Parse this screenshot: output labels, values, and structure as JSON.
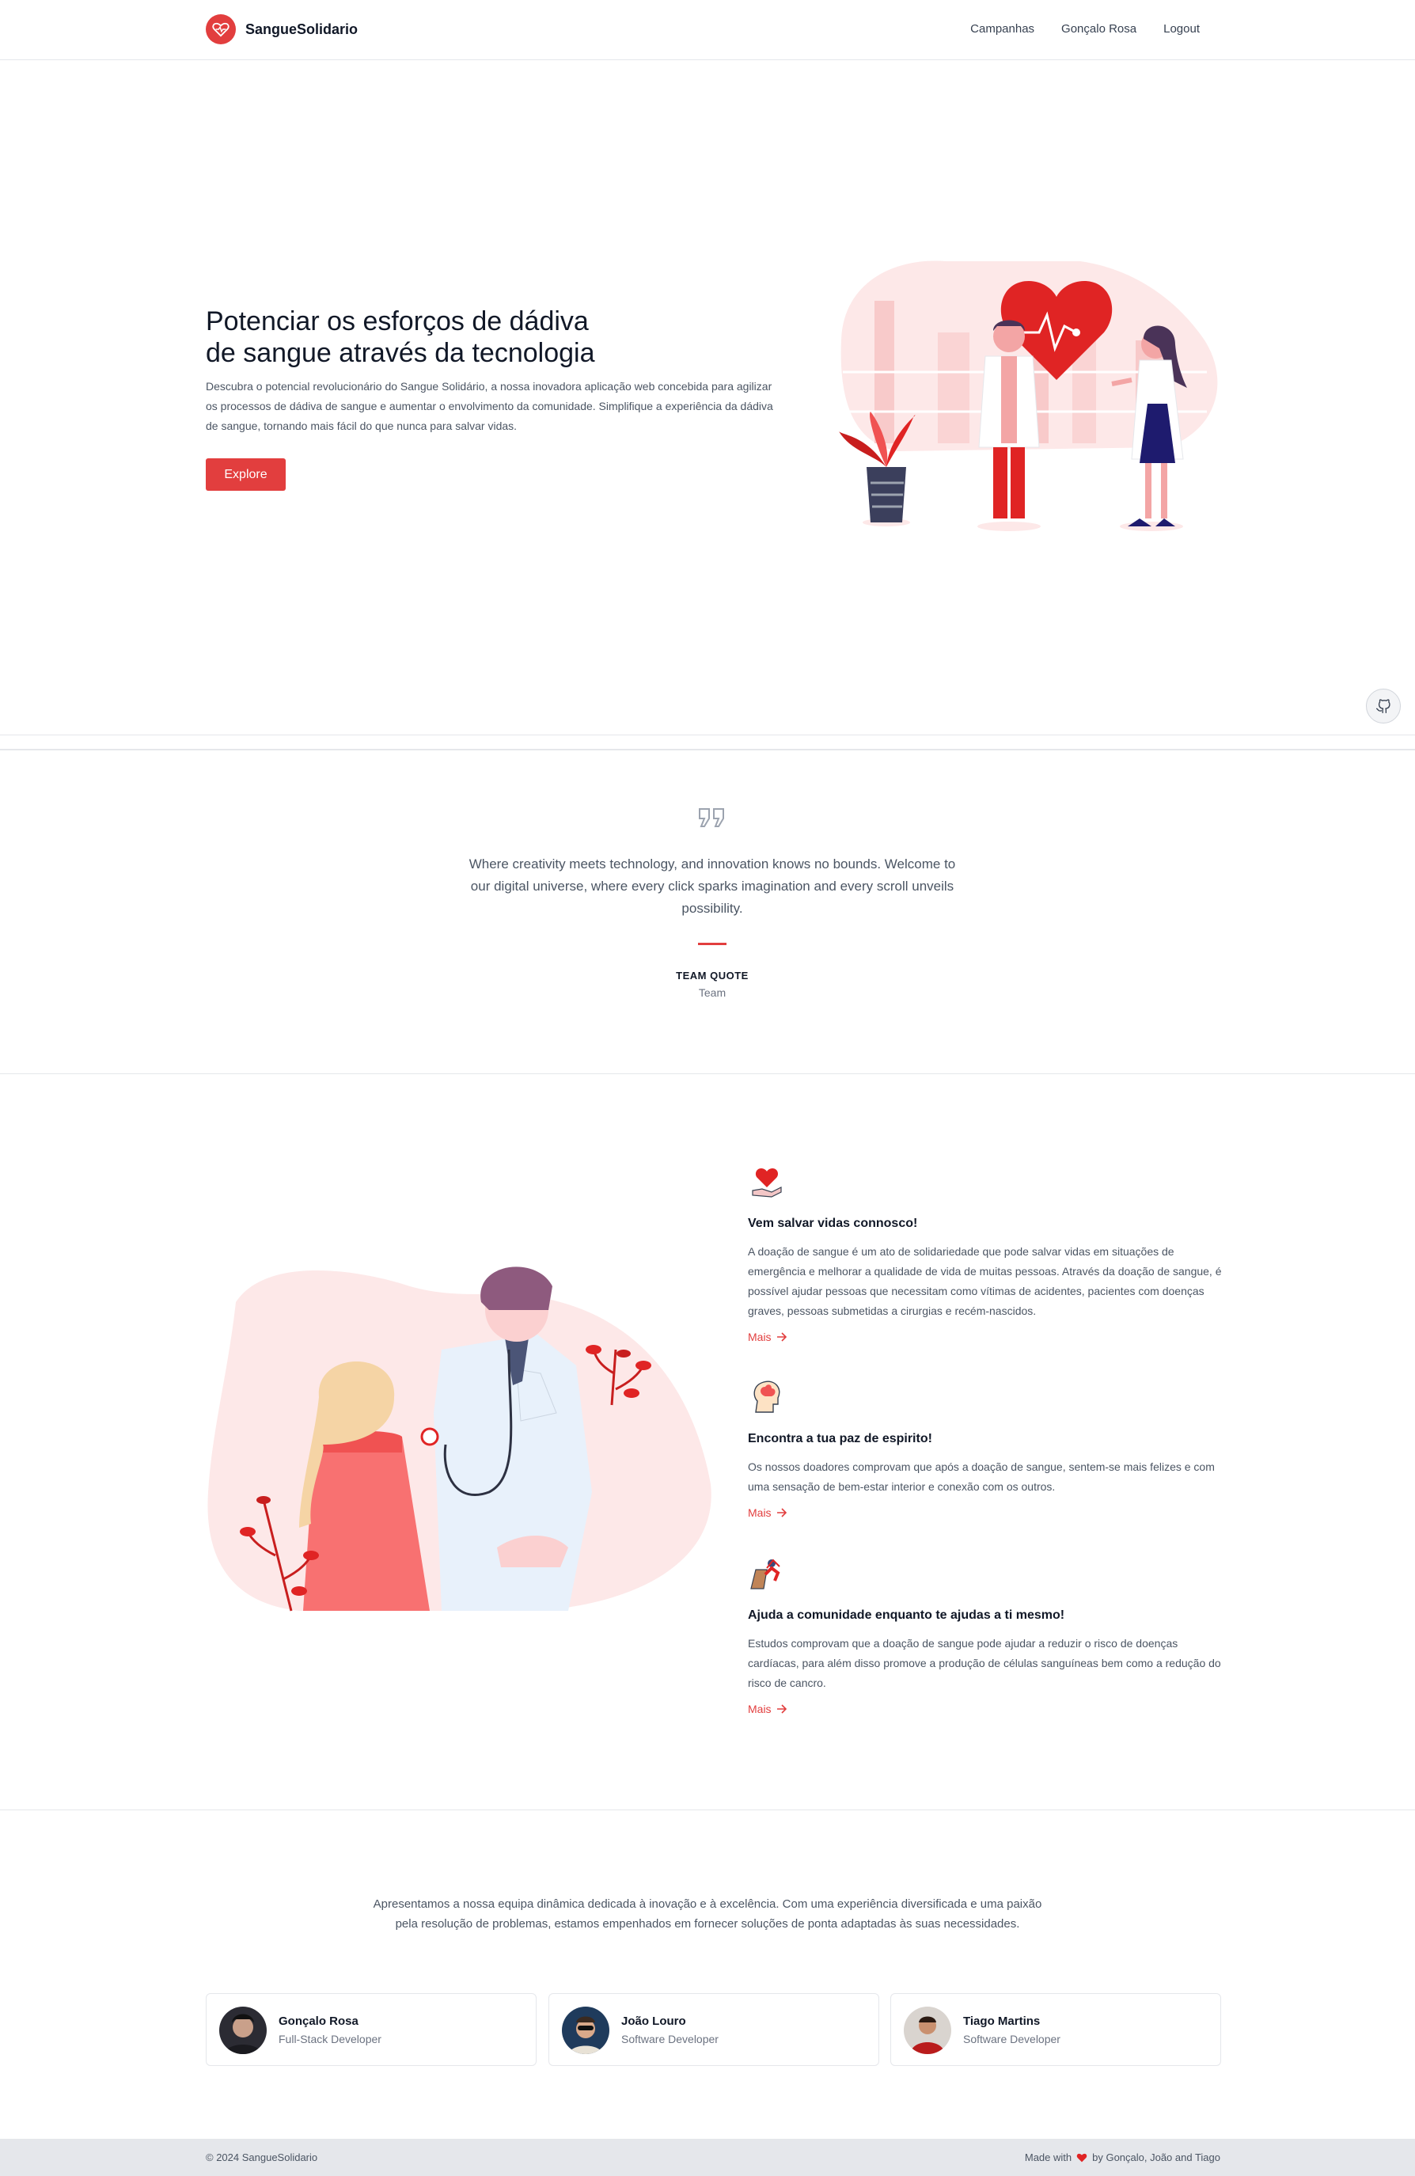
{
  "navbar": {
    "brand": "SangueSolidario",
    "links": [
      "Campanhas",
      "Gonçalo Rosa",
      "Logout"
    ]
  },
  "hero": {
    "title_line1": "Potenciar os esforços de dádiva",
    "title_line2": "de sangue através da tecnologia",
    "description": "Descubra o potencial revolucionário do Sangue Solidário, a nossa inovadora aplicação web concebida para agilizar os processos de dádiva de sangue e aumentar o envolvimento da comunidade. Simplifique a experiência da dádiva de sangue, tornando mais fácil do que nunca para salvar vidas.",
    "button": "Explore"
  },
  "quote": {
    "text": "Where creativity meets technology, and innovation knows no bounds. Welcome to our digital universe, where every click sparks imagination and every scroll unveils possibility.",
    "author": "TEAM QUOTE",
    "role": "Team"
  },
  "features": [
    {
      "icon": "heart-hand-icon",
      "title": "Vem salvar vidas connosco!",
      "description": "A doação de sangue é um ato de solidariedade que pode salvar vidas em situações de emergência e melhorar a qualidade de vida de muitas pessoas. Através da doação de sangue, é possível ajudar pessoas que necessitam como vítimas de acidentes, pacientes com doenças graves, pessoas submetidas a cirurgias e recém-nascidos.",
      "more": "Mais"
    },
    {
      "icon": "mind-icon",
      "title": "Encontra a tua paz de espirito!",
      "description": "Os nossos doadores comprovam que após a doação de sangue, sentem-se mais felizes e com uma sensação de bem-estar interior e conexão com os outros.",
      "more": "Mais"
    },
    {
      "icon": "community-icon",
      "title": "Ajuda a comunidade enquanto te ajudas a ti mesmo!",
      "description": "Estudos comprovam que a doação de sangue pode ajudar a reduzir o risco de doenças cardíacas, para além disso promove a produção de células sanguíneas bem como a redução do risco de cancro.",
      "more": "Mais"
    }
  ],
  "team": {
    "intro": "Apresentamos a nossa equipa dinâmica dedicada à inovação e à excelência. Com uma experiência diversificada e uma paixão pela resolução de problemas, estamos empenhados em fornecer soluções de ponta adaptadas às suas necessidades.",
    "members": [
      {
        "name": "Gonçalo Rosa",
        "role": "Full-Stack Developer"
      },
      {
        "name": "João Louro",
        "role": "Software Developer"
      },
      {
        "name": "Tiago Martins",
        "role": "Software Developer"
      }
    ]
  },
  "footer": {
    "copyright": "© 2024 SangueSolidario",
    "made_with": "Made with",
    "made_by": "by Gonçalo, João and Tiago"
  },
  "colors": {
    "accent": "#e23e3e",
    "border": "#e5e7eb",
    "footer_bg": "#e5e7eb"
  }
}
